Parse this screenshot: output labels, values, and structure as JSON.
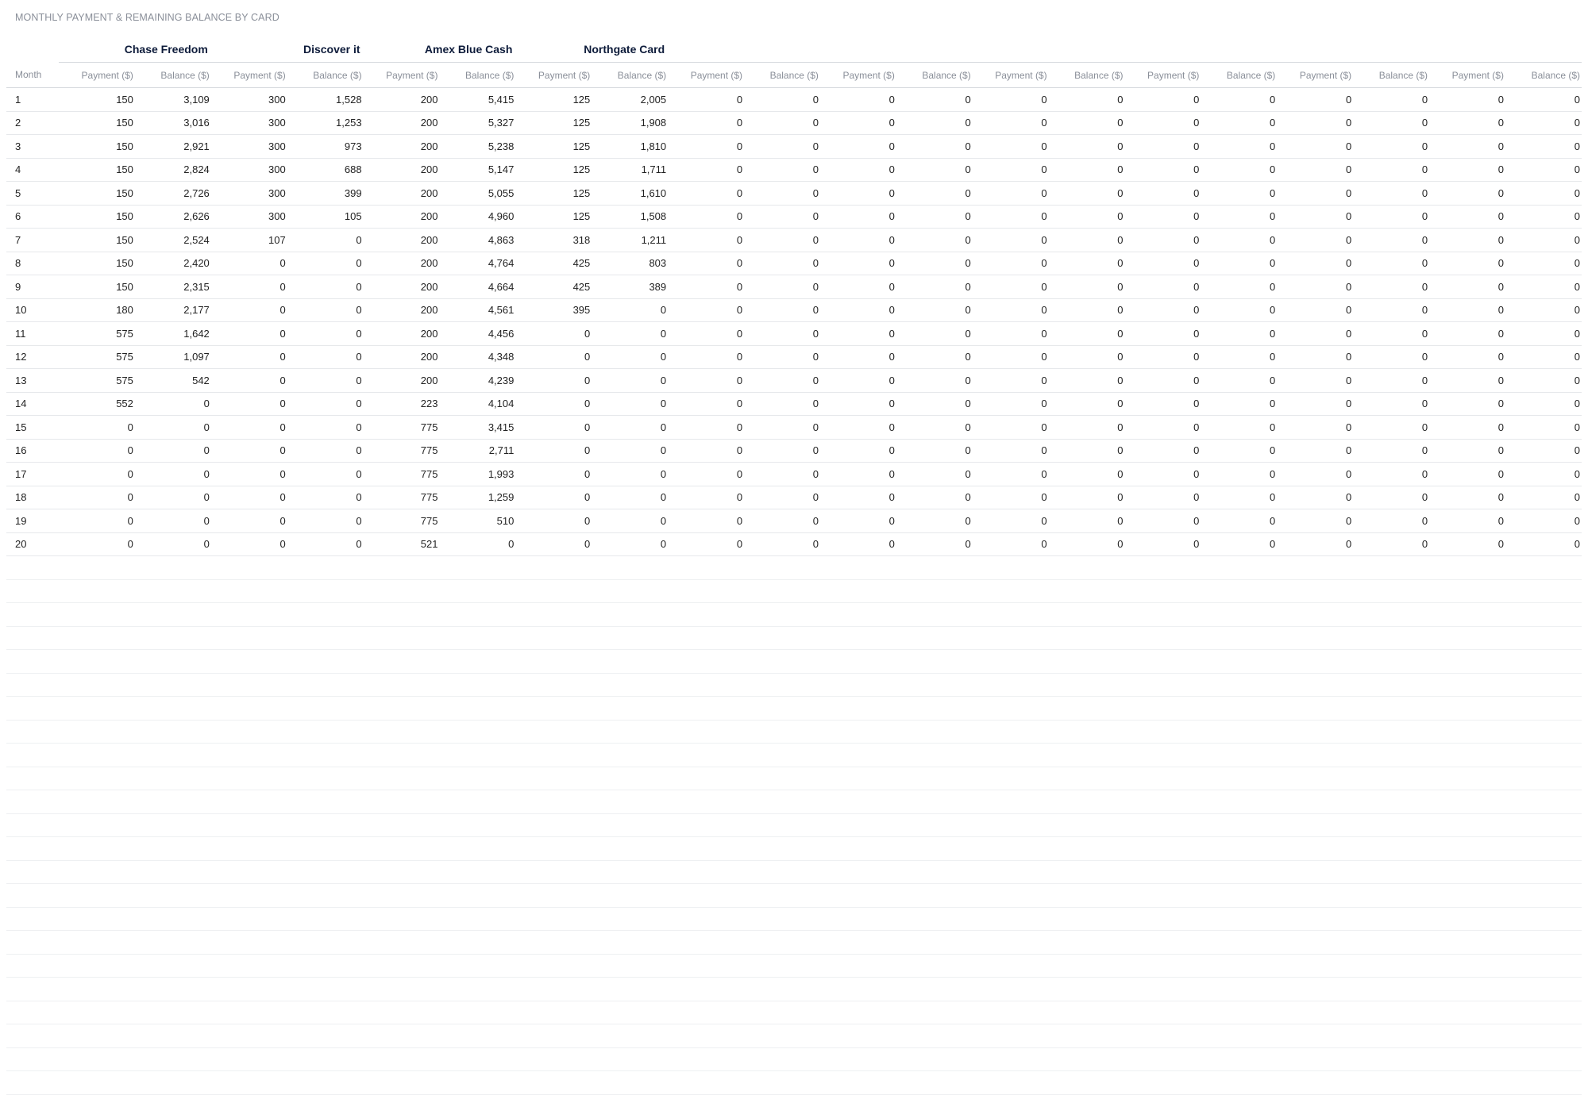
{
  "chart_data": {
    "type": "table",
    "title": "MONTHLY PAYMENT & REMAINING BALANCE BY CARD",
    "month_header": "Month",
    "payment_label": "Payment ($)",
    "balance_label": "Balance ($)",
    "cards": [
      "Chase Freedom",
      "Discover it",
      "Amex Blue Cash",
      "Northgate Card",
      "",
      "",
      "",
      "",
      "",
      ""
    ],
    "rows": [
      {
        "month": "1",
        "values": [
          "150",
          "3,109",
          "300",
          "1,528",
          "200",
          "5,415",
          "125",
          "2,005",
          "0",
          "0",
          "0",
          "0",
          "0",
          "0",
          "0",
          "0",
          "0",
          "0",
          "0",
          "0"
        ]
      },
      {
        "month": "2",
        "values": [
          "150",
          "3,016",
          "300",
          "1,253",
          "200",
          "5,327",
          "125",
          "1,908",
          "0",
          "0",
          "0",
          "0",
          "0",
          "0",
          "0",
          "0",
          "0",
          "0",
          "0",
          "0"
        ]
      },
      {
        "month": "3",
        "values": [
          "150",
          "2,921",
          "300",
          "973",
          "200",
          "5,238",
          "125",
          "1,810",
          "0",
          "0",
          "0",
          "0",
          "0",
          "0",
          "0",
          "0",
          "0",
          "0",
          "0",
          "0"
        ]
      },
      {
        "month": "4",
        "values": [
          "150",
          "2,824",
          "300",
          "688",
          "200",
          "5,147",
          "125",
          "1,711",
          "0",
          "0",
          "0",
          "0",
          "0",
          "0",
          "0",
          "0",
          "0",
          "0",
          "0",
          "0"
        ]
      },
      {
        "month": "5",
        "values": [
          "150",
          "2,726",
          "300",
          "399",
          "200",
          "5,055",
          "125",
          "1,610",
          "0",
          "0",
          "0",
          "0",
          "0",
          "0",
          "0",
          "0",
          "0",
          "0",
          "0",
          "0"
        ]
      },
      {
        "month": "6",
        "values": [
          "150",
          "2,626",
          "300",
          "105",
          "200",
          "4,960",
          "125",
          "1,508",
          "0",
          "0",
          "0",
          "0",
          "0",
          "0",
          "0",
          "0",
          "0",
          "0",
          "0",
          "0"
        ]
      },
      {
        "month": "7",
        "values": [
          "150",
          "2,524",
          "107",
          "0",
          "200",
          "4,863",
          "318",
          "1,211",
          "0",
          "0",
          "0",
          "0",
          "0",
          "0",
          "0",
          "0",
          "0",
          "0",
          "0",
          "0"
        ]
      },
      {
        "month": "8",
        "values": [
          "150",
          "2,420",
          "0",
          "0",
          "200",
          "4,764",
          "425",
          "803",
          "0",
          "0",
          "0",
          "0",
          "0",
          "0",
          "0",
          "0",
          "0",
          "0",
          "0",
          "0"
        ]
      },
      {
        "month": "9",
        "values": [
          "150",
          "2,315",
          "0",
          "0",
          "200",
          "4,664",
          "425",
          "389",
          "0",
          "0",
          "0",
          "0",
          "0",
          "0",
          "0",
          "0",
          "0",
          "0",
          "0",
          "0"
        ]
      },
      {
        "month": "10",
        "values": [
          "180",
          "2,177",
          "0",
          "0",
          "200",
          "4,561",
          "395",
          "0",
          "0",
          "0",
          "0",
          "0",
          "0",
          "0",
          "0",
          "0",
          "0",
          "0",
          "0",
          "0"
        ]
      },
      {
        "month": "11",
        "values": [
          "575",
          "1,642",
          "0",
          "0",
          "200",
          "4,456",
          "0",
          "0",
          "0",
          "0",
          "0",
          "0",
          "0",
          "0",
          "0",
          "0",
          "0",
          "0",
          "0",
          "0"
        ]
      },
      {
        "month": "12",
        "values": [
          "575",
          "1,097",
          "0",
          "0",
          "200",
          "4,348",
          "0",
          "0",
          "0",
          "0",
          "0",
          "0",
          "0",
          "0",
          "0",
          "0",
          "0",
          "0",
          "0",
          "0"
        ]
      },
      {
        "month": "13",
        "values": [
          "575",
          "542",
          "0",
          "0",
          "200",
          "4,239",
          "0",
          "0",
          "0",
          "0",
          "0",
          "0",
          "0",
          "0",
          "0",
          "0",
          "0",
          "0",
          "0",
          "0"
        ]
      },
      {
        "month": "14",
        "values": [
          "552",
          "0",
          "0",
          "0",
          "223",
          "4,104",
          "0",
          "0",
          "0",
          "0",
          "0",
          "0",
          "0",
          "0",
          "0",
          "0",
          "0",
          "0",
          "0",
          "0"
        ]
      },
      {
        "month": "15",
        "values": [
          "0",
          "0",
          "0",
          "0",
          "775",
          "3,415",
          "0",
          "0",
          "0",
          "0",
          "0",
          "0",
          "0",
          "0",
          "0",
          "0",
          "0",
          "0",
          "0",
          "0"
        ]
      },
      {
        "month": "16",
        "values": [
          "0",
          "0",
          "0",
          "0",
          "775",
          "2,711",
          "0",
          "0",
          "0",
          "0",
          "0",
          "0",
          "0",
          "0",
          "0",
          "0",
          "0",
          "0",
          "0",
          "0"
        ]
      },
      {
        "month": "17",
        "values": [
          "0",
          "0",
          "0",
          "0",
          "775",
          "1,993",
          "0",
          "0",
          "0",
          "0",
          "0",
          "0",
          "0",
          "0",
          "0",
          "0",
          "0",
          "0",
          "0",
          "0"
        ]
      },
      {
        "month": "18",
        "values": [
          "0",
          "0",
          "0",
          "0",
          "775",
          "1,259",
          "0",
          "0",
          "0",
          "0",
          "0",
          "0",
          "0",
          "0",
          "0",
          "0",
          "0",
          "0",
          "0",
          "0"
        ]
      },
      {
        "month": "19",
        "values": [
          "0",
          "0",
          "0",
          "0",
          "775",
          "510",
          "0",
          "0",
          "0",
          "0",
          "0",
          "0",
          "0",
          "0",
          "0",
          "0",
          "0",
          "0",
          "0",
          "0"
        ]
      },
      {
        "month": "20",
        "values": [
          "0",
          "0",
          "0",
          "0",
          "521",
          "0",
          "0",
          "0",
          "0",
          "0",
          "0",
          "0",
          "0",
          "0",
          "0",
          "0",
          "0",
          "0",
          "0",
          "0"
        ]
      }
    ]
  }
}
